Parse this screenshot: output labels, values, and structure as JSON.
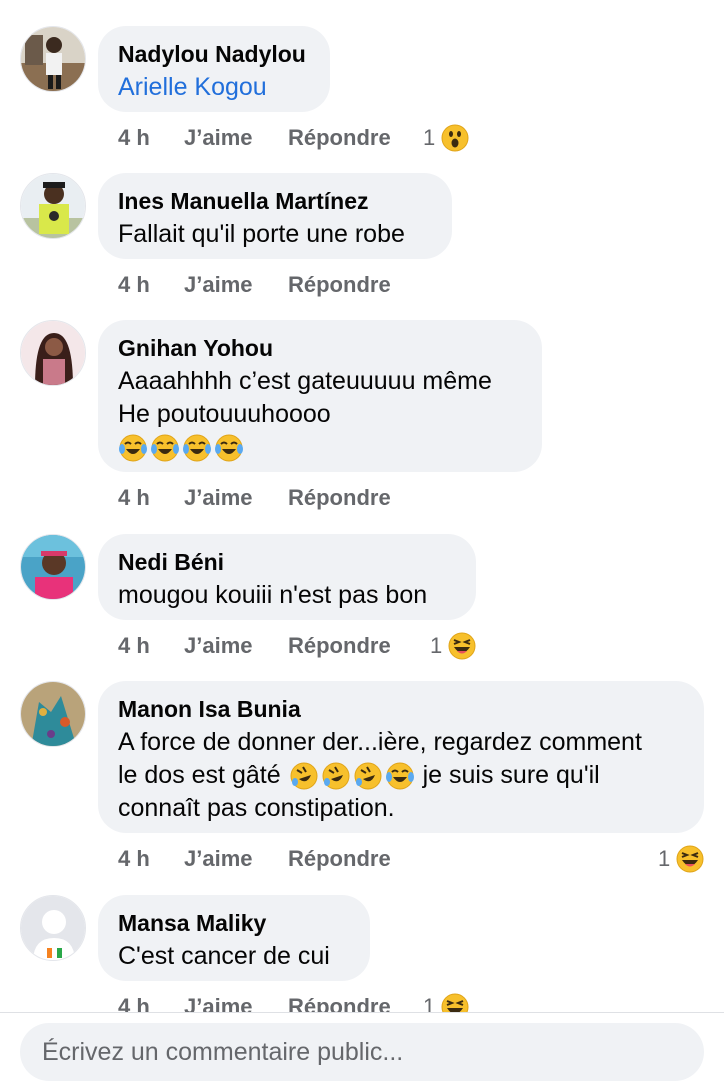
{
  "comments": [
    {
      "author": "Nadylou Nadylou",
      "text": "Arielle Kogou",
      "time": "4 h",
      "like": "J’aime",
      "reply": "Répondre",
      "reaction_count": "1",
      "reaction": "wow-icon"
    },
    {
      "author": "Ines Manuella Martínez",
      "text": "Fallait qu'il porte une robe",
      "time": "4 h",
      "like": "J’aime",
      "reply": "Répondre"
    },
    {
      "author": "Gnihan Yohou",
      "text_line1": "Aaaahhhh c’est gateuuuuu même",
      "text_line2": "He poutouuuhoooo",
      "time": "4 h",
      "like": "J’aime",
      "reply": "Répondre"
    },
    {
      "author": "Nedi Béni",
      "text": "mougou kouiii n'est pas bon",
      "time": "4 h",
      "like": "J’aime",
      "reply": "Répondre",
      "reaction_count": "1",
      "reaction": "haha-icon"
    },
    {
      "author": "Manon Isa Bunia",
      "text_line1": "A force de donner der...ière, regardez comment",
      "text_line2_a": "le dos est gâté",
      "text_line2_b": "je suis sure qu'il",
      "text_line3": "connaît pas constipation.",
      "time": "4 h",
      "like": "J’aime",
      "reply": "Répondre",
      "reaction_count": "1",
      "reaction": "haha-icon"
    },
    {
      "author": "Mansa Maliky",
      "text": "C'est cancer de cui",
      "time": "4 h",
      "like": "J’aime",
      "reply": "Répondre",
      "reaction_count": "1",
      "reaction": "haha-icon"
    }
  ],
  "composer": {
    "placeholder": "Écrivez un commentaire public..."
  },
  "colors": {
    "link": "#216fdb",
    "bubble": "#f0f2f5",
    "meta": "#65676b",
    "emoji": "#f7c02c"
  }
}
